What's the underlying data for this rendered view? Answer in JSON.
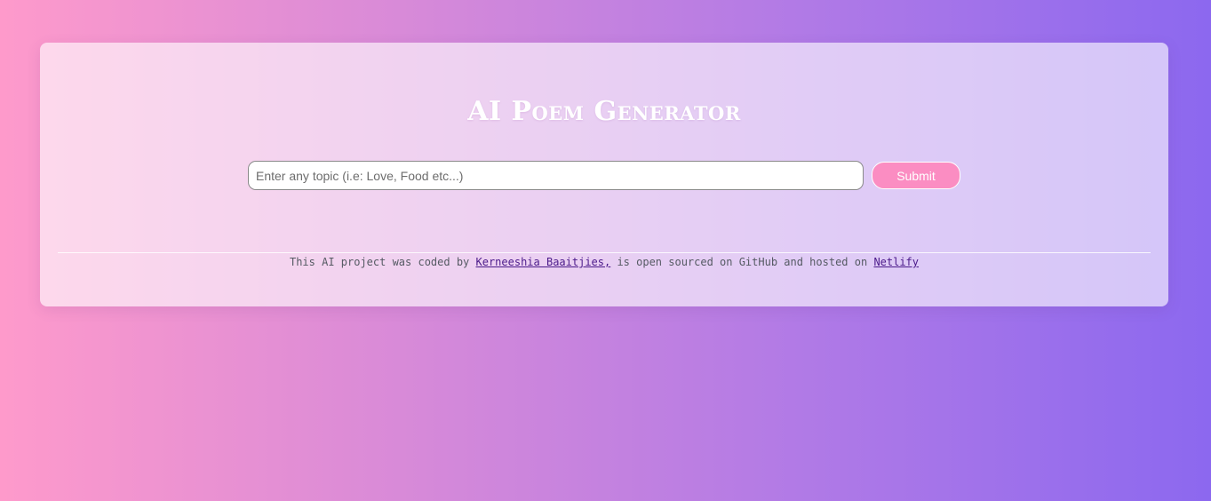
{
  "app": {
    "title": "AI Poem Generator"
  },
  "form": {
    "input_placeholder": "Enter any topic (i.e: Love, Food etc...)",
    "input_value": "",
    "submit_label": "Submit"
  },
  "footer": {
    "text_before_author": "This AI project was coded by ",
    "author_link": "Kerneeshia Baaitjies,",
    "text_middle": " is open sourced on GitHub and hosted on ",
    "host_link": "Netlify"
  },
  "colors": {
    "background_gradient_start": "#fe9acb",
    "background_gradient_end": "#8c68ef",
    "submit_button": "#fb8dc2",
    "link": "#4b1a8a",
    "title": "#ffffff"
  }
}
